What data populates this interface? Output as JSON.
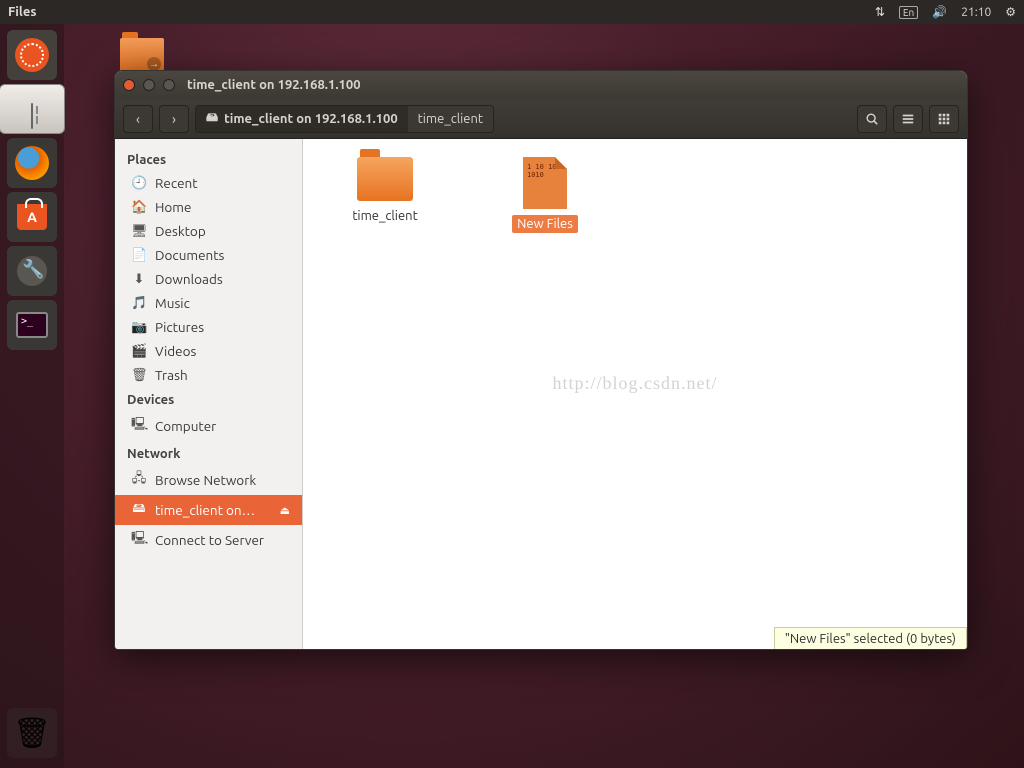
{
  "menubar": {
    "app": "Files",
    "lang": "En",
    "time": "21:10"
  },
  "launcher": {
    "items": [
      "dash",
      "files",
      "firefox",
      "software",
      "settings",
      "terminal"
    ],
    "softwareGlyph": "A"
  },
  "window": {
    "title": "time_client on 192.168.1.100",
    "path": {
      "root": "time_client on 192.168.1.100",
      "current": "time_client"
    }
  },
  "sidebar": {
    "sections": [
      {
        "head": "Places",
        "items": [
          {
            "icon": "🕘",
            "label": "Recent"
          },
          {
            "icon": "🏠",
            "label": "Home"
          },
          {
            "icon": "🖥",
            "label": "Desktop"
          },
          {
            "icon": "📄",
            "label": "Documents"
          },
          {
            "icon": "⬇",
            "label": "Downloads"
          },
          {
            "icon": "🎵",
            "label": "Music"
          },
          {
            "icon": "📷",
            "label": "Pictures"
          },
          {
            "icon": "🎬",
            "label": "Videos"
          },
          {
            "icon": "🗑",
            "label": "Trash"
          }
        ]
      },
      {
        "head": "Devices",
        "items": [
          {
            "icon": "🖳",
            "label": "Computer"
          }
        ]
      },
      {
        "head": "Network",
        "items": [
          {
            "icon": "🖧",
            "label": "Browse Network"
          },
          {
            "icon": "🖴",
            "label": "time_client on…",
            "active": true,
            "eject": true
          },
          {
            "icon": "🖳",
            "label": "Connect to Server"
          }
        ]
      }
    ]
  },
  "files": [
    {
      "type": "folder",
      "name": "time_client",
      "selected": false
    },
    {
      "type": "code",
      "name": "New Files",
      "selected": true,
      "codetext": "1\n10\n101\n1010"
    }
  ],
  "watermark": "http://blog.csdn.net/",
  "status": "\"New Files\" selected  (0 bytes)"
}
